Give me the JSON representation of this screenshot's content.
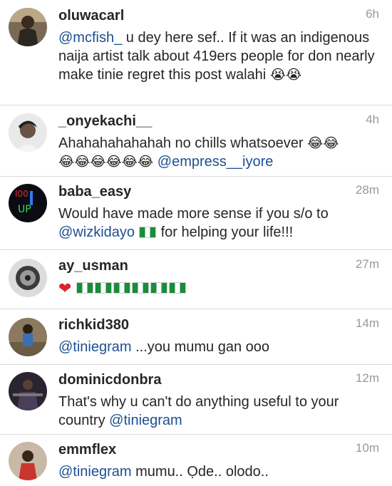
{
  "comments": [
    {
      "username": "oluwacarl",
      "time": "6h",
      "mention": "@mcfish_",
      "text": " u dey here sef.. If it was an indigenous naija artist talk about 419ers people for don nearly make tinie regret this post walahi ",
      "emoji": "😭😭"
    },
    {
      "username": "_onyekachi__",
      "time": "4h",
      "text": "Ahahahahahahah no chills whatsoever ",
      "emoji_a": "😂😂",
      "emoji_b": "😂😂😂😂😂😂",
      "mention": " @empress__iyore"
    },
    {
      "username": "baba_easy",
      "time": "28m",
      "text_a": "Would have made more sense if you s/o to ",
      "mention": "@wizkidayo",
      "text_b": " for helping your life!!!"
    },
    {
      "username": "ay_usman",
      "time": "27m",
      "heart": "❤"
    },
    {
      "username": "richkid380",
      "time": "14m",
      "mention": "@tiniegram",
      "text": " ...you mumu gan ooo"
    },
    {
      "username": "dominicdonbra",
      "time": "12m",
      "text": "That's why u can't do anything useful to your country ",
      "mention": "@tiniegram"
    },
    {
      "username": "emmflex",
      "time": "10m",
      "mention": "@tiniegram",
      "text": " mumu.. Ọde.. olodo.."
    }
  ]
}
